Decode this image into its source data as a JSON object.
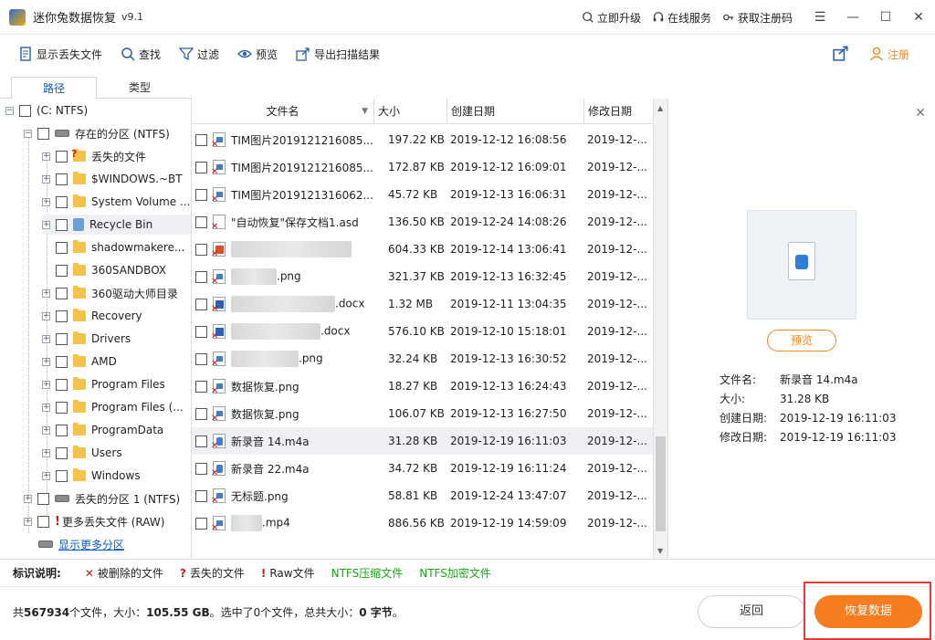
{
  "window": {
    "title": "迷你兔数据恢复",
    "version": "v9.1"
  },
  "titlebar_links": [
    {
      "label": "立即升级"
    },
    {
      "label": "在线服务"
    },
    {
      "label": "获取注册码"
    }
  ],
  "toolbar": {
    "show_lost": "显示丢失文件",
    "find": "查找",
    "filter": "过滤",
    "preview": "预览",
    "export": "导出扫描结果",
    "register": "注册"
  },
  "tabs": {
    "path": "路径",
    "type": "类型"
  },
  "tree": {
    "root": "(C: NTFS)",
    "existing": "存在的分区 (NTFS)",
    "items": [
      "丢失的文件",
      "$WINDOWS.~BT",
      "System Volume ...",
      "Recycle Bin",
      "shadowmakere...",
      "360SANDBOX",
      "360驱动大师目录",
      "Recovery",
      "Drivers",
      "AMD",
      "Program Files",
      "Program Files (...",
      "ProgramData",
      "Users",
      "Windows"
    ],
    "lost_partition": "丢失的分区 1 (NTFS)",
    "raw": "更多丢失文件 (RAW)",
    "more": "显示更多分区"
  },
  "columns": {
    "name": "文件名",
    "size": "大小",
    "created": "创建日期",
    "modified": "修改日期"
  },
  "files": [
    {
      "name": "TIM图片2019121216085...",
      "size": "197.22 KB",
      "created": "2019-12-12 16:08:56",
      "modified": "2019-12-..."
    },
    {
      "name": "TIM图片2019121216085...",
      "size": "172.87 KB",
      "created": "2019-12-12 16:09:01",
      "modified": "2019-12-..."
    },
    {
      "name": "TIM图片2019121316062...",
      "size": "45.72 KB",
      "created": "2019-12-13 16:06:31",
      "modified": "2019-12-..."
    },
    {
      "name": "\"自动恢复\"保存文档1.asd",
      "size": "136.50 KB",
      "created": "2019-12-24 14:08:26",
      "modified": "2019-12-..."
    },
    {
      "name": "",
      "size": "604.33 KB",
      "created": "2019-12-14 13:06:41",
      "modified": "2019-12-..."
    },
    {
      "name": ".png",
      "size": "321.37 KB",
      "created": "2019-12-13 16:32:45",
      "modified": "2019-12-..."
    },
    {
      "name": ".docx",
      "size": "1.32 MB",
      "created": "2019-12-11 13:04:35",
      "modified": "2019-12-..."
    },
    {
      "name": ".docx",
      "size": "576.10 KB",
      "created": "2019-12-10 15:18:01",
      "modified": "2019-12-..."
    },
    {
      "name": ".png",
      "size": "32.24 KB",
      "created": "2019-12-13 16:30:52",
      "modified": "2019-12-..."
    },
    {
      "name": "数据恢复.png",
      "size": "18.27 KB",
      "created": "2019-12-13 16:24:43",
      "modified": "2019-12-..."
    },
    {
      "name": "数据恢复.png",
      "size": "106.07 KB",
      "created": "2019-12-13 16:27:50",
      "modified": "2019-12-..."
    },
    {
      "name": "新录音 14.m4a",
      "size": "31.28 KB",
      "created": "2019-12-19 16:11:03",
      "modified": "2019-12-..."
    },
    {
      "name": "新录音 22.m4a",
      "size": "34.72 KB",
      "created": "2019-12-19 16:11:24",
      "modified": "2019-12-..."
    },
    {
      "name": "无标题.png",
      "size": "58.81 KB",
      "created": "2019-12-24 13:47:07",
      "modified": "2019-12-..."
    },
    {
      "name": ".mp4",
      "size": "886.56 KB",
      "created": "2019-12-19 14:59:09",
      "modified": "2019-12-..."
    }
  ],
  "preview_panel": {
    "button": "预览",
    "labels": {
      "name": "文件名:",
      "size": "大小:",
      "created": "创建日期:",
      "modified": "修改日期:"
    },
    "values": {
      "name": "新录音 14.m4a",
      "size": "31.28 KB",
      "created": "2019-12-19 16:11:03",
      "modified": "2019-12-19 16:11:03"
    }
  },
  "legend": {
    "title": "标识说明:",
    "deleted": "被删除的文件",
    "lost": "丢失的文件",
    "raw": "Raw文件",
    "ntfs_compressed": "NTFS压缩文件",
    "ntfs_encrypted": "NTFS加密文件"
  },
  "status": {
    "p1": "共",
    "count": "567934",
    "p2": "个文件，大小：",
    "size": "105.55 GB",
    "p3": "。选中了0个文件，总共大小：",
    "selsize": "0 字节",
    "p4": "。"
  },
  "buttons": {
    "back": "返回",
    "recover": "恢复数据"
  }
}
